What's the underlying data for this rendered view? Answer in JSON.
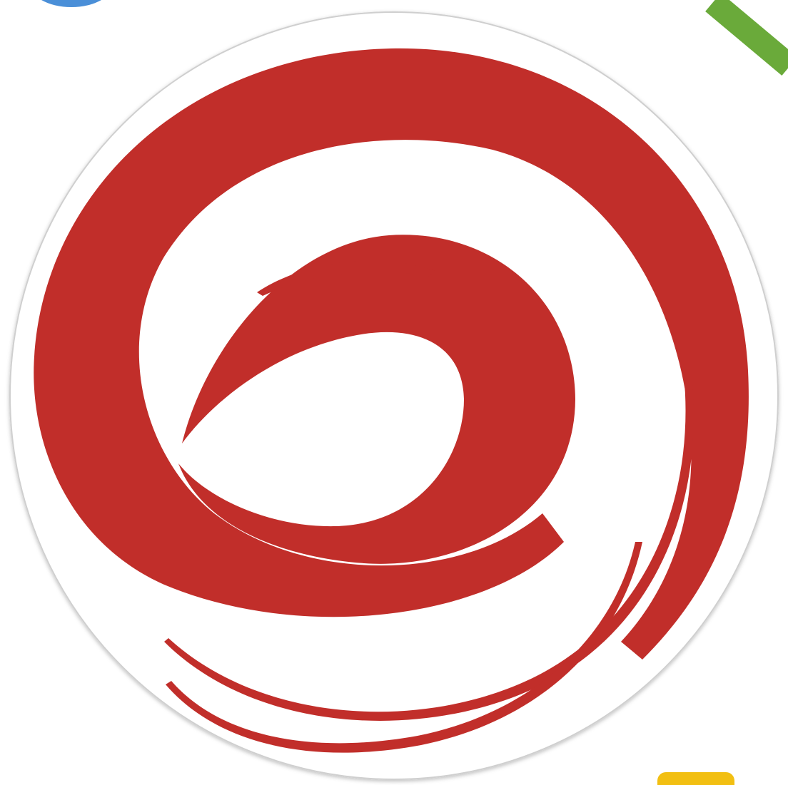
{
  "logo": {
    "icon": "red-swirl-logo-icon",
    "mark_color": "#c12e2a",
    "badge_color": "#ffffff",
    "badge_border_color": "#c9c9c9"
  },
  "decorations": {
    "top_left": {
      "icon": "blue-circle-fragment",
      "color": "#4a8fd8"
    },
    "top_right": {
      "icon": "green-stripe-fragment",
      "color": "#6aaa3a"
    },
    "bottom_right": {
      "icon": "yellow-tab-fragment",
      "color": "#f2bf12"
    }
  }
}
